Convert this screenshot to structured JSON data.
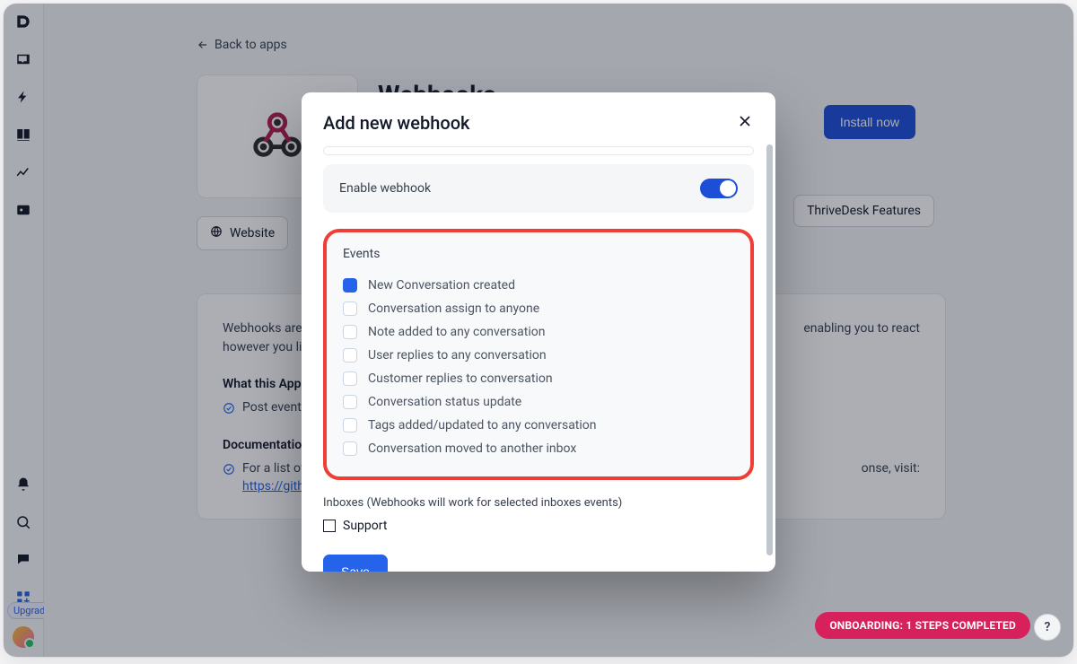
{
  "nav": {
    "upgrade": "Upgrade"
  },
  "backlink": "Back to apps",
  "page": {
    "title": "Webhooks"
  },
  "install_button": "Install now",
  "chips": {
    "website": "Website",
    "features": "ThriveDesk Features"
  },
  "content": {
    "intro1": "Webhooks are w",
    "intro_tail": "enabling you to react",
    "intro2": "however you lik",
    "heading_whatapp": "What this App",
    "bullet_post": "Post event d",
    "heading_docs": "Documentatio",
    "docs_line": "For a list of",
    "docs_tail": "onse, visit:",
    "docs_link": "https://githu"
  },
  "modal": {
    "title": "Add new webhook",
    "enable_label": "Enable webhook",
    "events_title": "Events",
    "events": [
      {
        "label": "New Conversation created",
        "checked": true
      },
      {
        "label": "Conversation assign to anyone",
        "checked": false
      },
      {
        "label": "Note added to any conversation",
        "checked": false
      },
      {
        "label": "User replies to any conversation",
        "checked": false
      },
      {
        "label": "Customer replies to conversation",
        "checked": false
      },
      {
        "label": "Conversation status update",
        "checked": false
      },
      {
        "label": "Tags added/updated to any conversation",
        "checked": false
      },
      {
        "label": "Conversation moved to another inbox",
        "checked": false
      }
    ],
    "inboxes_label": "Inboxes (Webhooks will work for selected inboxes events)",
    "inbox_option": "Support",
    "save": "Save"
  },
  "onboarding": "ONBOARDING: 1 STEPS COMPLETED",
  "help": "?"
}
